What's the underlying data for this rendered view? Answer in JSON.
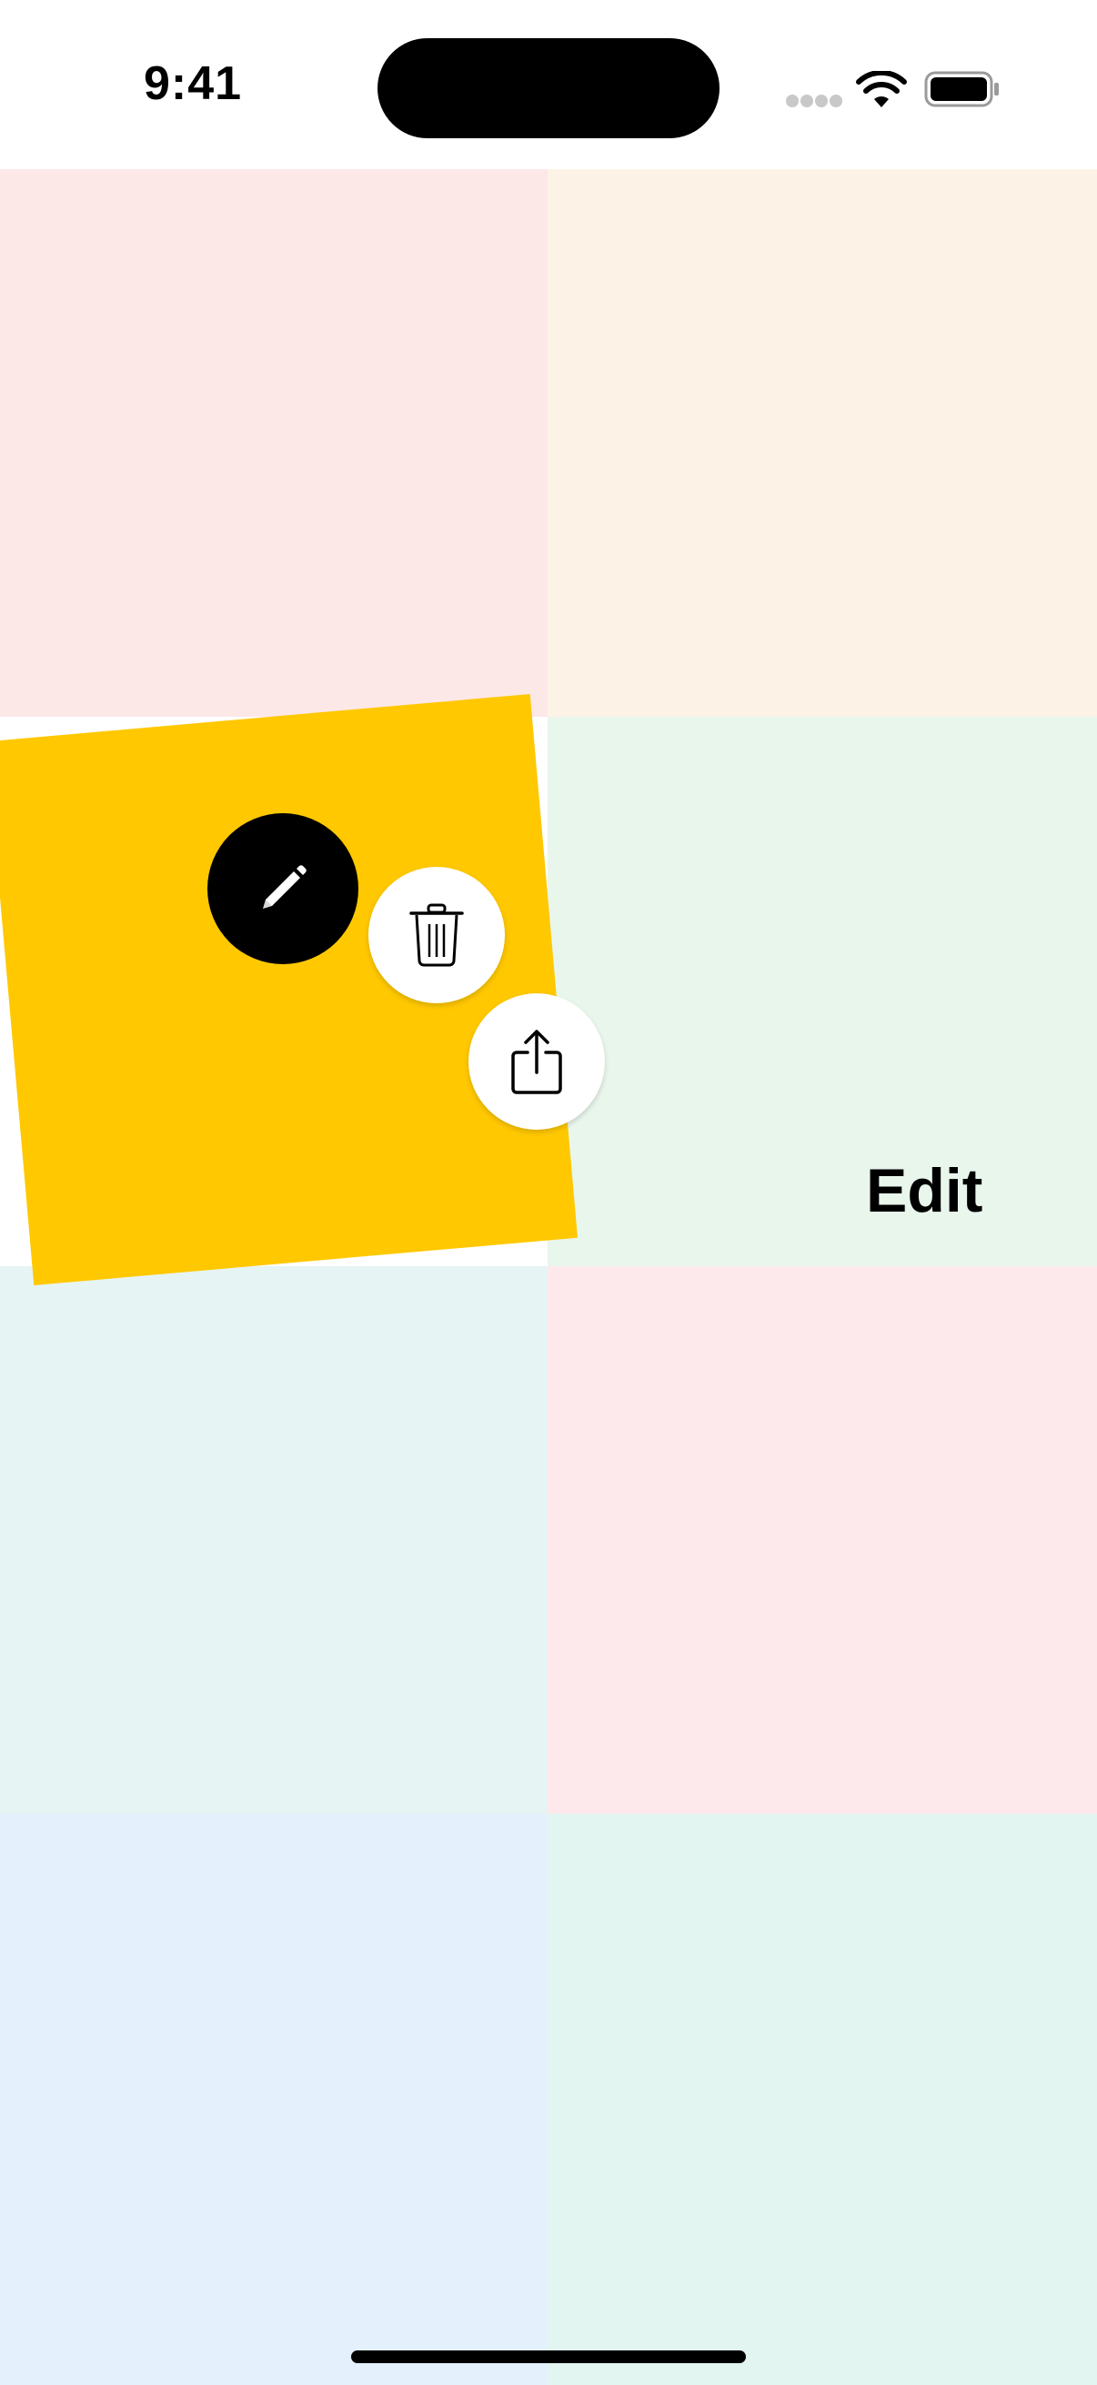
{
  "status_bar": {
    "time": "9:41",
    "icons": [
      "signal-dots-icon",
      "wifi-icon",
      "battery-icon"
    ]
  },
  "grid": {
    "tiles": [
      {
        "color": "#fde8e8"
      },
      {
        "color": "#fdf2e6"
      },
      {
        "color": "#e9f6ec"
      },
      {
        "color": "#e6f4f3"
      },
      {
        "color": "#fde9ec"
      },
      {
        "color": "#e4f0fb"
      },
      {
        "color": "#e2f5f1"
      }
    ],
    "edit_label": "Edit"
  },
  "selected_note": {
    "color": "#ffc800",
    "actions": [
      {
        "name": "edit",
        "icon": "pencil-icon"
      },
      {
        "name": "delete",
        "icon": "trash-icon"
      },
      {
        "name": "share",
        "icon": "share-icon"
      }
    ]
  }
}
